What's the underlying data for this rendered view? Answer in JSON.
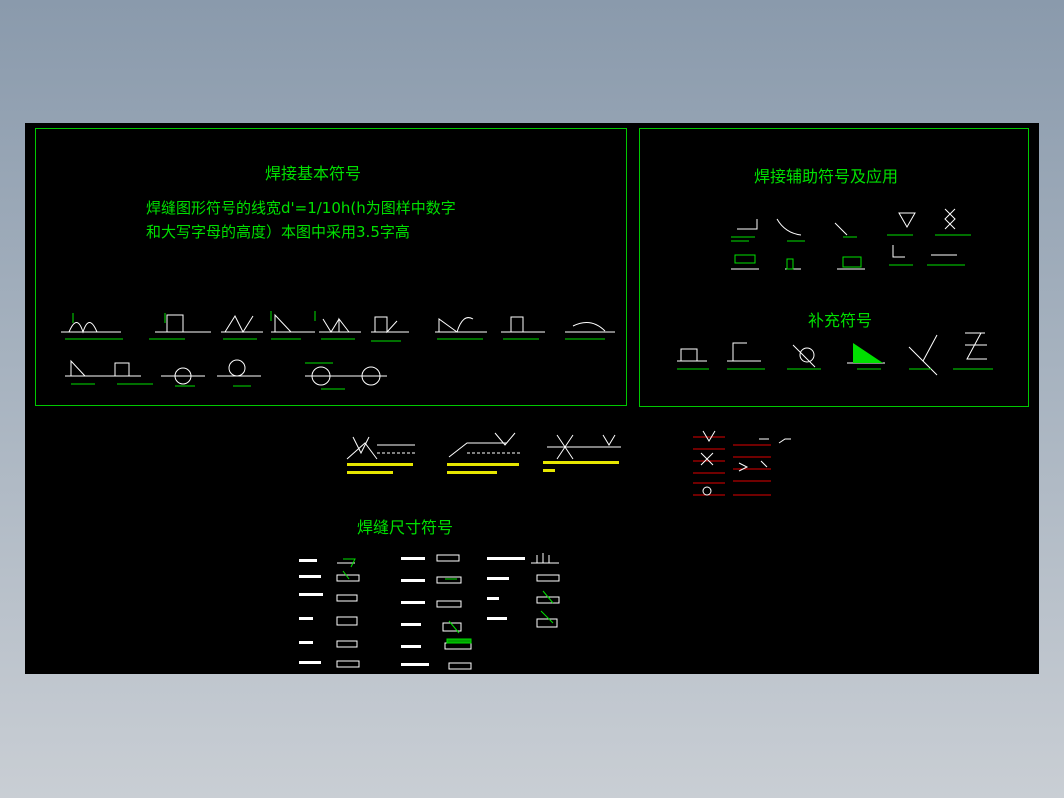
{
  "drawing": {
    "basic_title": "焊接基本符号",
    "basic_note_line1": "焊缝图形符号的线宽d'=1/10h(h为图样中数字",
    "basic_note_line2": "和大写字母的高度）本图中采用3.5字高",
    "aux_title": "焊接辅助符号及应用",
    "supp_title": "补充符号",
    "size_title": "焊缝尺寸符号"
  },
  "colors": {
    "background": "#000000",
    "frame": "#00c800",
    "text": "#00e000",
    "yellow": "#e6e600",
    "white": "#ffffff",
    "red": "#e00000",
    "cyan": "#00d8d8"
  }
}
